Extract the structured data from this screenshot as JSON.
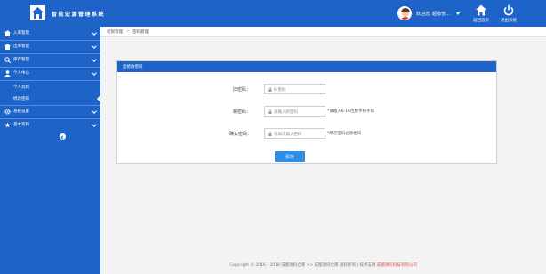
{
  "header": {
    "logo_text": "智能宏源管理系统",
    "user_name": "欢迎您, 超级管...",
    "buttons": [
      {
        "label": "返回首页",
        "icon": "home-icon"
      },
      {
        "label": "退出系统",
        "icon": "power-icon"
      }
    ]
  },
  "sidebar": {
    "items": [
      {
        "label": "入库管理",
        "icon": "home-icon",
        "expanded": false
      },
      {
        "label": "出库管理",
        "icon": "outbound-icon",
        "expanded": false
      },
      {
        "label": "库存管理",
        "icon": "inventory-icon",
        "expanded": false
      },
      {
        "label": "个人中心",
        "icon": "user-icon",
        "expanded": true,
        "children": [
          {
            "label": "个人资料"
          },
          {
            "label": "修改密码",
            "active": true
          }
        ]
      },
      {
        "label": "系统设置",
        "icon": "gear-icon",
        "expanded": false
      },
      {
        "label": "基本资料",
        "icon": "data-icon",
        "expanded": false
      }
    ]
  },
  "breadcrumb": {
    "parent": "权限管理",
    "separator": ">",
    "current": "密码管理"
  },
  "form": {
    "title": "您修改密码",
    "fields": [
      {
        "label": "旧密码：",
        "placeholder": "旧密码",
        "hint": ""
      },
      {
        "label": "新密码：",
        "placeholder": "请输入新密码",
        "hint": "*请输入6-16位数字和字母"
      },
      {
        "label": "确认密码：",
        "placeholder": "请再次输入密码",
        "hint": "*两次密码必须相同"
      }
    ],
    "save_label": "保存"
  },
  "footer": {
    "text": "Copyright © 2016 - 2018 成都源码仓库 >> 成都源码仓库 版权所有 | 技术支持",
    "company": "成都源码科技有限公司"
  },
  "colors": {
    "primary": "#1e64c8",
    "button": "#2d8ee8",
    "footer_link": "#d9544f"
  }
}
